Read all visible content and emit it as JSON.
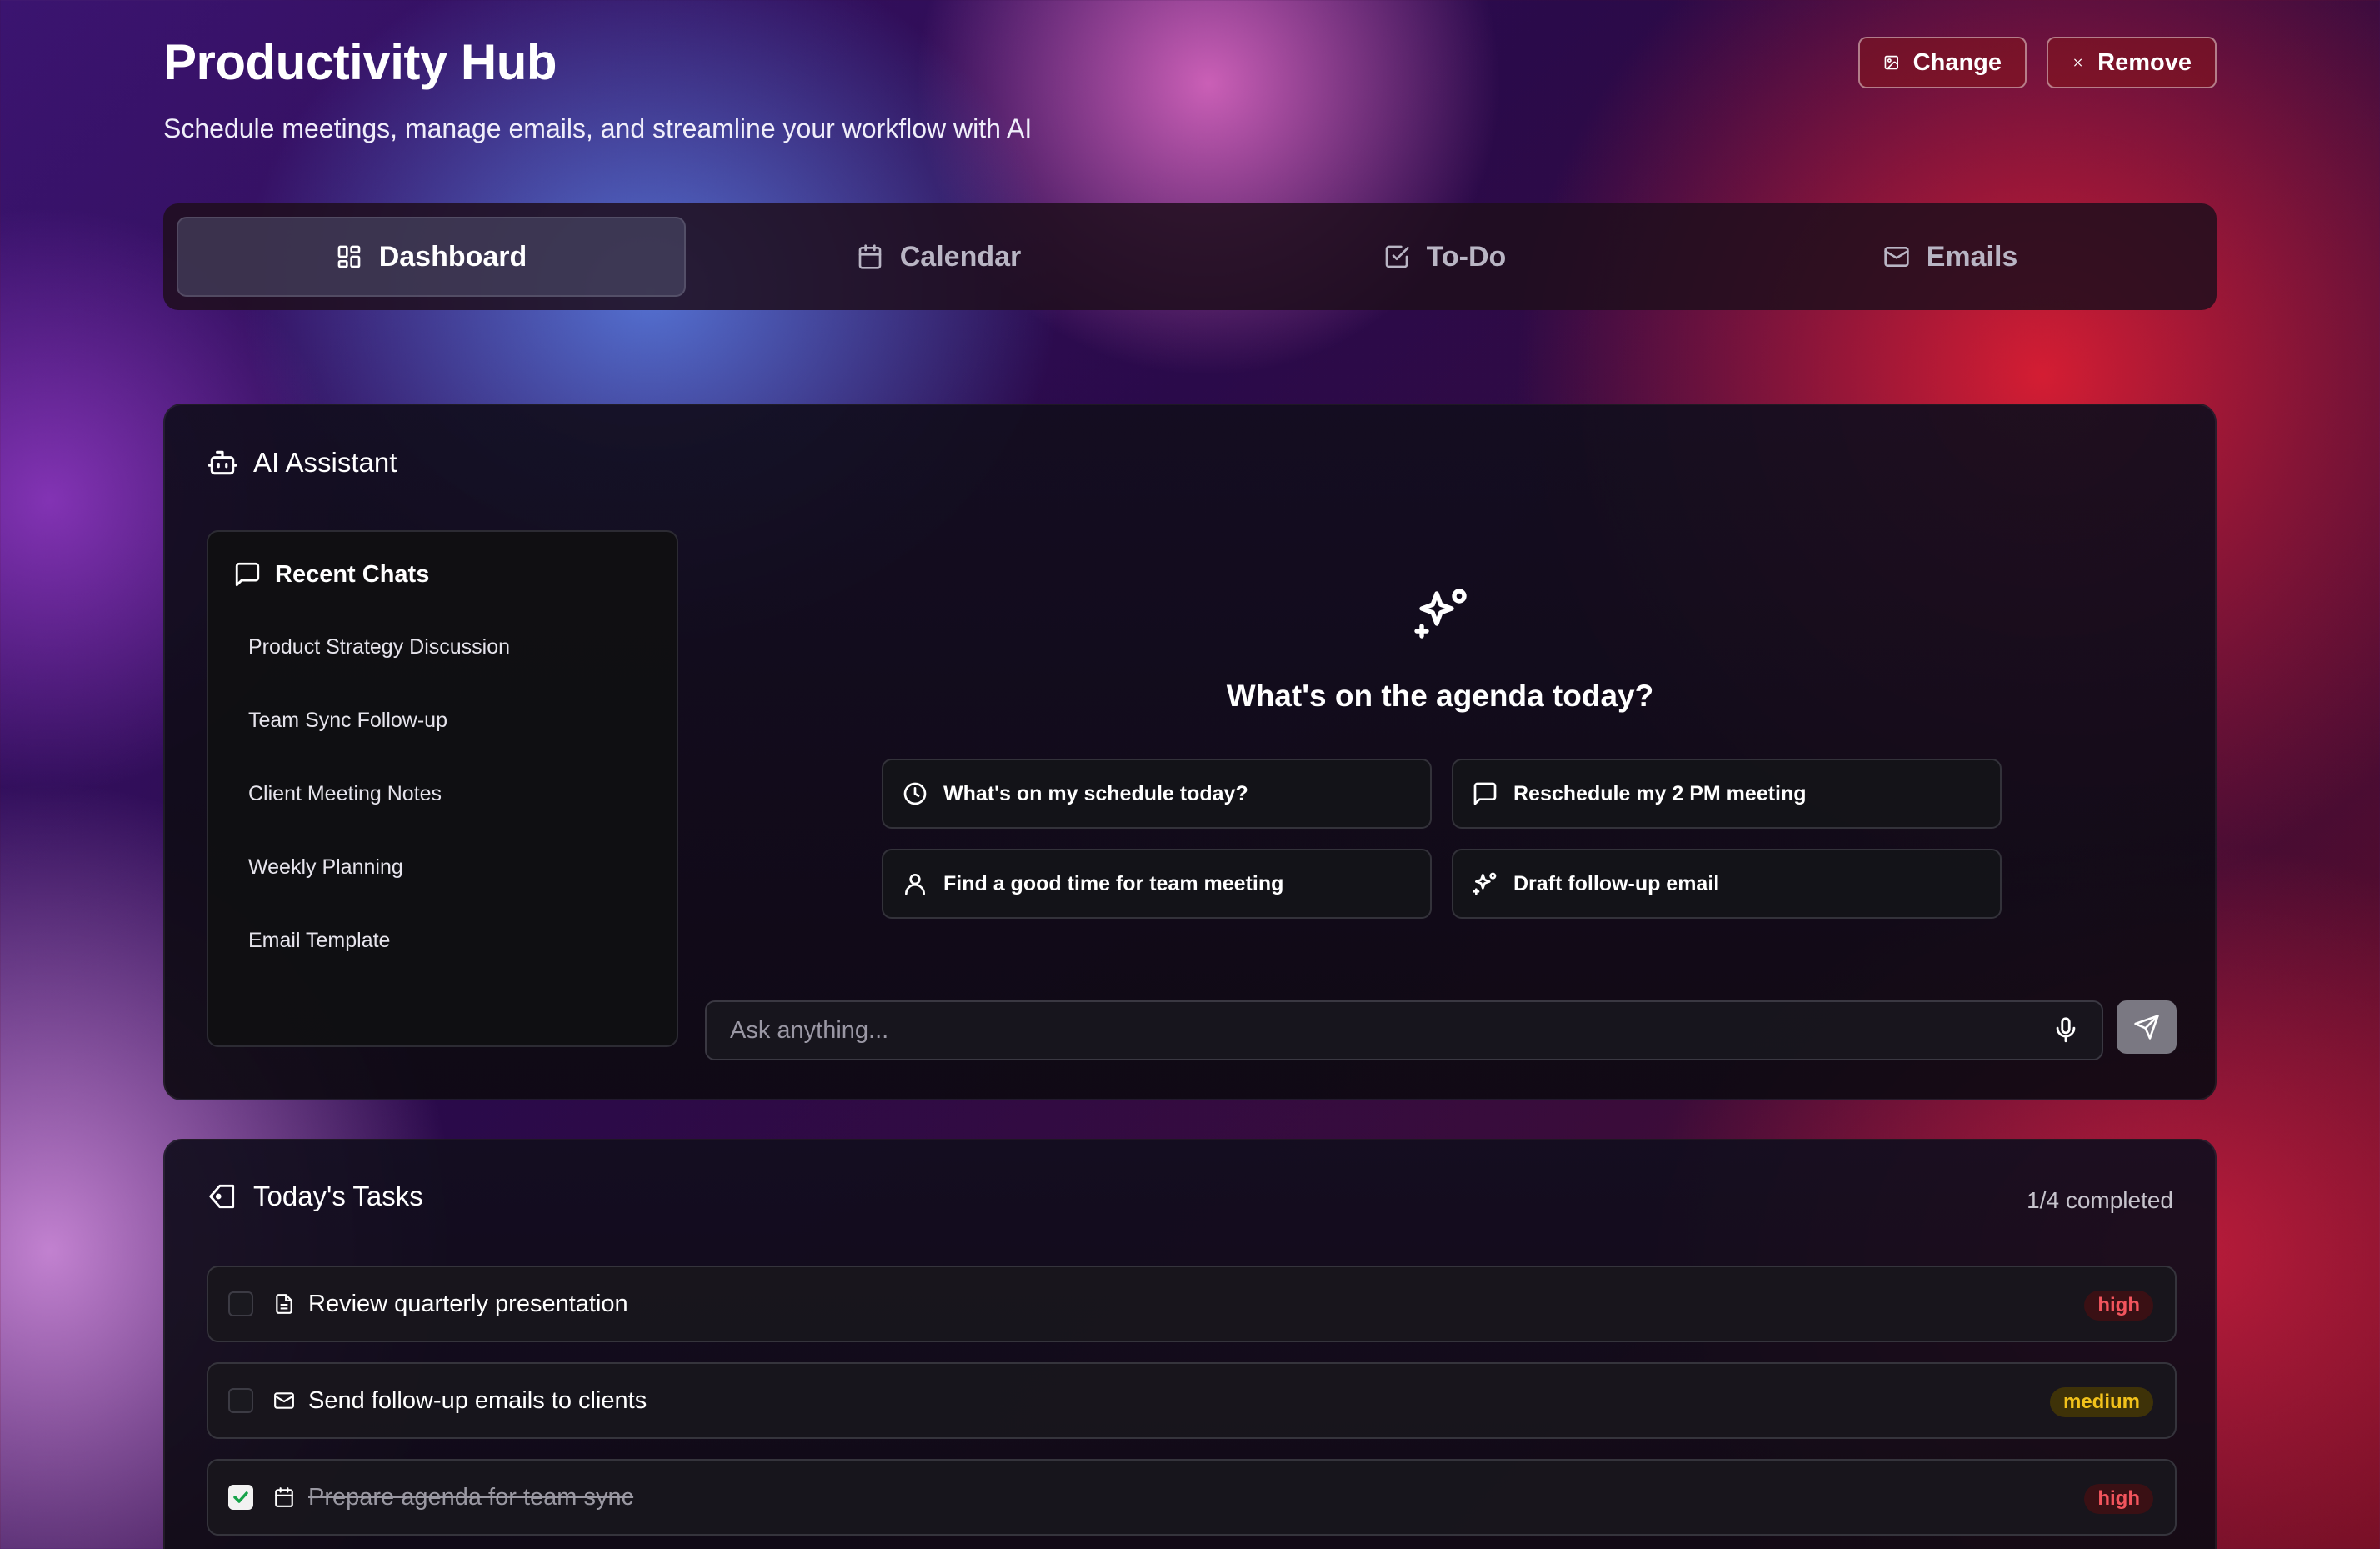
{
  "header": {
    "title": "Productivity Hub",
    "subtitle": "Schedule meetings, manage emails, and streamline your workflow with AI",
    "change_label": "Change",
    "remove_label": "Remove"
  },
  "tabs": [
    {
      "label": "Dashboard",
      "icon": "grid-icon",
      "active": true
    },
    {
      "label": "Calendar",
      "icon": "calendar-icon",
      "active": false
    },
    {
      "label": "To-Do",
      "icon": "check-square-icon",
      "active": false
    },
    {
      "label": "Emails",
      "icon": "mail-icon",
      "active": false
    }
  ],
  "assistant": {
    "title": "AI Assistant",
    "recent_title": "Recent Chats",
    "recent_chats": [
      "Product Strategy Discussion",
      "Team Sync Follow-up",
      "Client Meeting Notes",
      "Weekly Planning",
      "Email Template"
    ],
    "prompt_heading": "What's on the agenda today?",
    "suggestions": [
      {
        "label": "What's on my schedule today?",
        "icon": "clock-icon"
      },
      {
        "label": "Reschedule my 2 PM meeting",
        "icon": "message-square-icon"
      },
      {
        "label": "Find a good time for team meeting",
        "icon": "user-icon"
      },
      {
        "label": "Draft follow-up email",
        "icon": "sparkles-icon"
      }
    ],
    "input_placeholder": "Ask anything..."
  },
  "tasks": {
    "title": "Today's Tasks",
    "completed_text": "1/4 completed",
    "items": [
      {
        "label": "Review quarterly presentation",
        "icon": "document-icon",
        "priority": "high",
        "done": false
      },
      {
        "label": "Send follow-up emails to clients",
        "icon": "mail-icon",
        "priority": "medium",
        "done": false
      },
      {
        "label": "Prepare agenda for team sync",
        "icon": "calendar-icon",
        "priority": "high",
        "done": true
      }
    ]
  },
  "colors": {
    "high_badge": "#f2555d",
    "medium_badge": "#f2c21b"
  }
}
